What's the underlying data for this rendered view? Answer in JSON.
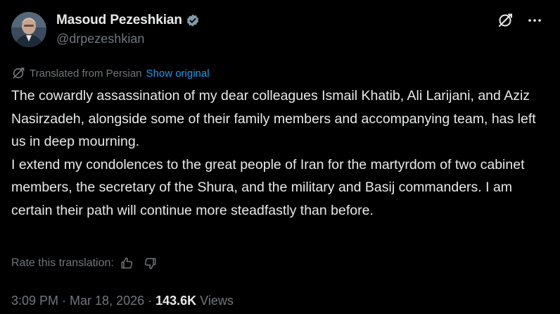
{
  "author": {
    "display_name": "Masoud Pezeshkian",
    "handle": "@drpezeshkian",
    "verified": true,
    "verified_badge_color": "#829aab"
  },
  "header_actions": {
    "icons": [
      "translate-icon",
      "more-options-icon"
    ]
  },
  "translation": {
    "label": "Translated from Persian",
    "show_original_label": "Show original",
    "link_color": "#1d9bf0"
  },
  "tweet": {
    "paragraphs": [
      "The cowardly assassination of my dear colleagues Ismail Khatib, Ali Larijani, and Aziz Nasirzadeh, alongside some of their family members and accompanying team, has left us in deep mourning.",
      "I extend my condolences to the great people of Iran for the martyrdom of two cabinet members, the secretary of the Shura, and the military and Basij commanders. I am certain their path will continue more steadfastly than before."
    ]
  },
  "rate": {
    "label": "Rate this translation:",
    "icons": [
      "thumbs-up-icon",
      "thumbs-down-icon"
    ]
  },
  "meta": {
    "time": "3:09 PM",
    "separator": "·",
    "date": "Mar 18, 2026",
    "views_count": "143.6K",
    "views_label": "Views"
  },
  "colors": {
    "background": "#000000",
    "text_primary": "#e7e9ea",
    "text_secondary": "#71767b"
  }
}
